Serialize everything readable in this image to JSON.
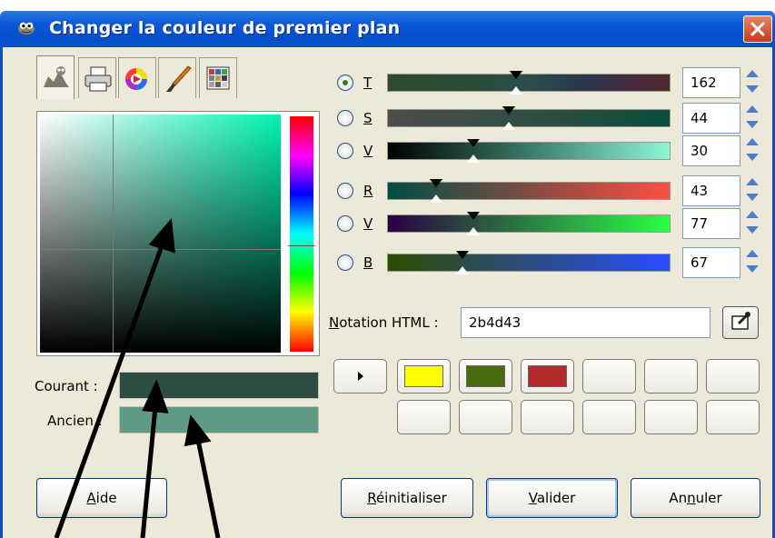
{
  "window": {
    "title": "Changer la couleur de premier plan"
  },
  "tabs": [
    {
      "name": "gimp-selector-tab-icon"
    },
    {
      "name": "cmyk-printer-tab-icon"
    },
    {
      "name": "color-wheel-tab-icon"
    },
    {
      "name": "watercolor-brush-tab-icon"
    },
    {
      "name": "palette-scale-tab-icon"
    }
  ],
  "channels": [
    {
      "letter": "T",
      "value": "162",
      "selected": true
    },
    {
      "letter": "S",
      "value": "44",
      "selected": false
    },
    {
      "letter": "V",
      "value": "30",
      "selected": false
    },
    {
      "letter": "R",
      "value": "43",
      "selected": false
    },
    {
      "letter": "V",
      "value": "77",
      "selected": false
    },
    {
      "letter": "B",
      "value": "67",
      "selected": false
    }
  ],
  "html_notation": {
    "label": "Notation HTML :",
    "value": "2b4d43"
  },
  "current_label": "Courant :",
  "old_label": "Ancien :",
  "colors": {
    "current": "#2b4d43",
    "old": "#5e9a86",
    "history": [
      "#ffff00",
      "#4a6a10",
      "#b22a2a",
      "#ffffff",
      "#ffffff",
      "#ffffff",
      "#ffffff",
      "#ffffff",
      "#ffffff",
      "#ffffff",
      "#ffffff",
      "#ffffff"
    ]
  },
  "buttons": {
    "help": "Aide",
    "reset": "Réinitialiser",
    "ok": "Valider",
    "cancel": "Annuler"
  }
}
